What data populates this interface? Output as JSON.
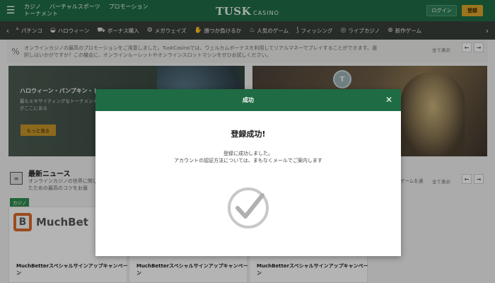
{
  "header": {
    "nav_items": [
      "カジノ",
      "バーチャルスポーツ",
      "プロモーション",
      "トーナメント"
    ],
    "brand": "TUSK",
    "brand_suffix": "CASINO",
    "login_label": "ログイン",
    "register_label": "登録"
  },
  "category_nav": {
    "items": [
      {
        "label": "パチンコ",
        "icon": "cherry-icon"
      },
      {
        "label": "ハロウィーン",
        "icon": "pumpkin-icon"
      },
      {
        "label": "ボーナス購入",
        "icon": "cart-icon"
      },
      {
        "label": "メガウェイズ",
        "icon": "ways-icon"
      },
      {
        "label": "勝つか負けるか",
        "icon": "handshake-icon"
      },
      {
        "label": "人気のゲーム",
        "icon": "flame-icon"
      },
      {
        "label": "フィッシング",
        "icon": "fish-icon"
      },
      {
        "label": "ライブカジノ",
        "icon": "chip-icon"
      },
      {
        "label": "新作ゲーム",
        "icon": "new-icon"
      }
    ]
  },
  "info_banner": {
    "text": "オンラインカジノの最高のプロモーションをご用意しました。TuskCasinoでは、ウェルカムボーナスを利用してリアルマネーでプレイすることができます。選択しはいかがですか？この機会に、オンラインルーレットやオンラインスロットマシンをぜひお試しください。",
    "view_all": "全て表示"
  },
  "promo": {
    "title": "ハロウィーン・パンプキン・ト",
    "desc": "最もエキサイティングなトーナメントがここにある",
    "button_label": "もっと見る",
    "coin_letter": "T"
  },
  "news": {
    "title": "最新ニュース",
    "desc": "オンラインカジノの世界に関したための最高のコツをお届",
    "right_text": "ゲームを通",
    "view_all": "全て表示",
    "tag": "カジノ",
    "card_logo": "MuchBet",
    "card_titles": [
      "MuchBetterスペシャルサインアップキャンペーン",
      "MuchBetterスペシャルサインアップキャンペーン",
      "MuchBetterスペシャルサインアップキャンペーン"
    ]
  },
  "modal": {
    "title": "成功",
    "heading": "登録成功!",
    "message_line1": "登録に成功しました。",
    "message_line2": "アカウントの認証方法については、まもなくメールでご案内します"
  }
}
